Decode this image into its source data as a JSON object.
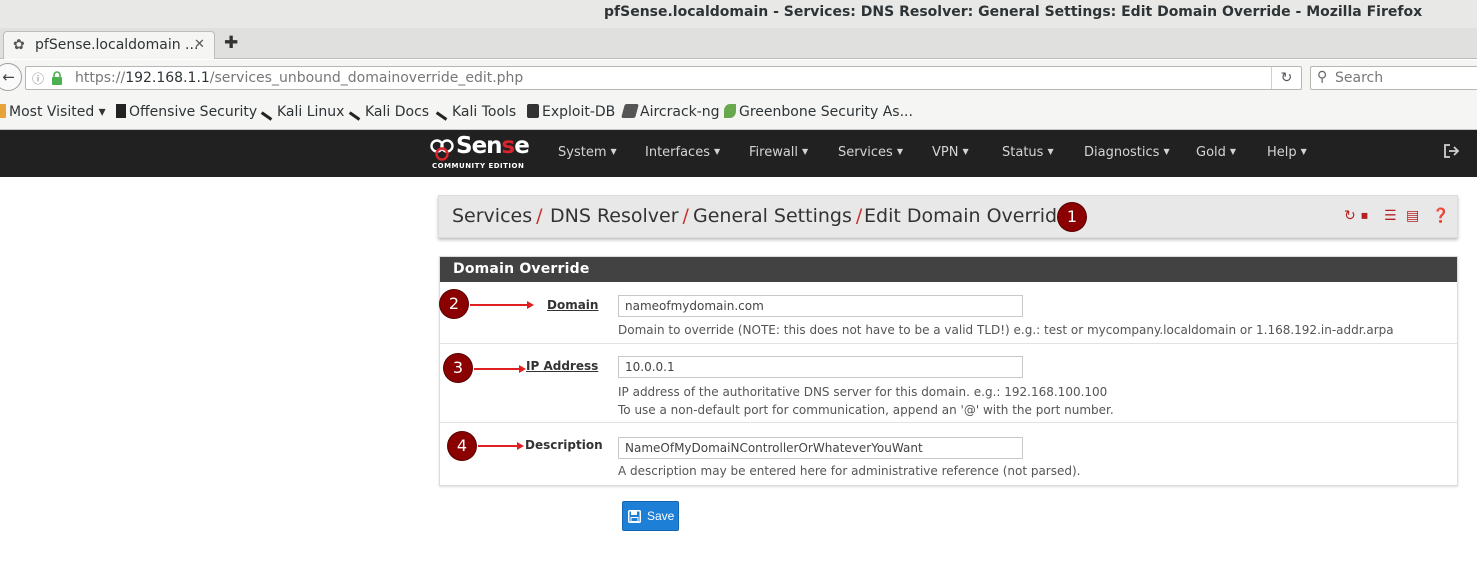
{
  "window": {
    "title": "pfSense.localdomain - Services: DNS Resolver: General Settings: Edit Domain Override - Mozilla Firefox"
  },
  "tab": {
    "label": "pfSense.localdomain ...",
    "close": "✕",
    "new_tab": "✚"
  },
  "navbar": {
    "url_scheme": "https://",
    "url_host": "192.168.1.1",
    "url_path": "/services_unbound_domainoverride_edit.php",
    "search_placeholder": "Search"
  },
  "bookmarks": [
    {
      "label": "Most Visited ▾",
      "icon": "folder-icon"
    },
    {
      "label": "Offensive Security",
      "icon": "offsec-icon"
    },
    {
      "label": "Kali Linux",
      "icon": "kali-icon"
    },
    {
      "label": "Kali Docs",
      "icon": "kali-icon"
    },
    {
      "label": "Kali Tools",
      "icon": "kali-icon"
    },
    {
      "label": "Exploit-DB",
      "icon": "exploitdb-icon"
    },
    {
      "label": "Aircrack-ng",
      "icon": "aircrack-icon"
    },
    {
      "label": "Greenbone Security As...",
      "icon": "greenbone-icon"
    }
  ],
  "pfsense": {
    "logo_text_1": "Sen",
    "logo_text_2": "s",
    "logo_text_3": "e",
    "logo_sub": "COMMUNITY EDITION",
    "menu": [
      "System",
      "Interfaces",
      "Firewall",
      "Services",
      "VPN",
      "Status",
      "Diagnostics",
      "Gold",
      "Help"
    ]
  },
  "breadcrumb": [
    {
      "label": "Services",
      "sep": "/"
    },
    {
      "label": "DNS Resolver",
      "sep": "/"
    },
    {
      "label": "General Settings",
      "sep": "/"
    },
    {
      "label": "Edit Domain Override",
      "sep": ""
    }
  ],
  "markers": [
    "1",
    "2",
    "3",
    "4"
  ],
  "panel": {
    "heading": "Domain Override",
    "domain": {
      "label": "Domain",
      "value": "nameofmydomain.com",
      "help": "Domain to override (NOTE: this does not have to be a valid TLD!) e.g.: test or mycompany.localdomain or 1.168.192.in-addr.arpa"
    },
    "ip": {
      "label": "IP Address",
      "value": "10.0.0.1",
      "help1": "IP address of the authoritative DNS server for this domain. e.g.: 192.168.100.100",
      "help2": "To use a non-default port for communication, append an '@' with the port number."
    },
    "description": {
      "label": "Description",
      "value": "NameOfMyDomaiNControllerOrWhateverYouWant",
      "help": "A description may be entered here for administrative reference (not parsed)."
    }
  },
  "save_label": "Save",
  "colors": {
    "nav_bg": "#212121",
    "heading_bg": "#424242",
    "marker": "#8b0000",
    "accent_red": "#c9302c",
    "save_blue": "#1e7fd6"
  }
}
